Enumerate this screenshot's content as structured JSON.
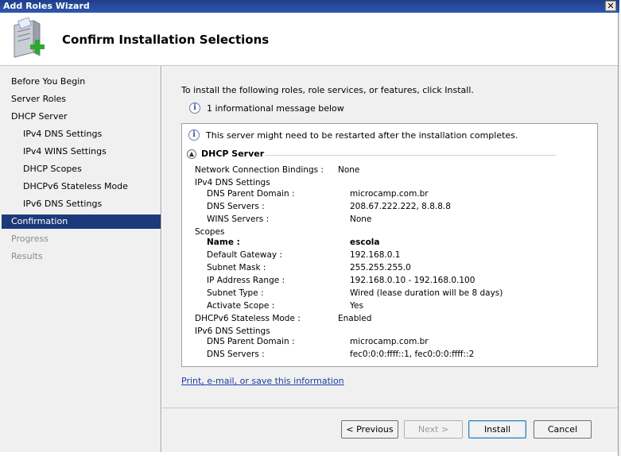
{
  "window": {
    "title": "Add Roles Wizard",
    "close_glyph": "✕"
  },
  "header": {
    "title": "Confirm Installation Selections",
    "icon": "server-add-icon"
  },
  "sidebar": {
    "items": [
      {
        "label": "Before You Begin",
        "state": "normal",
        "level": 0
      },
      {
        "label": "Server Roles",
        "state": "normal",
        "level": 0
      },
      {
        "label": "DHCP Server",
        "state": "normal",
        "level": 0
      },
      {
        "label": "IPv4 DNS Settings",
        "state": "normal",
        "level": 1
      },
      {
        "label": "IPv4 WINS Settings",
        "state": "normal",
        "level": 1
      },
      {
        "label": "DHCP Scopes",
        "state": "normal",
        "level": 1
      },
      {
        "label": "DHCPv6 Stateless Mode",
        "state": "normal",
        "level": 1
      },
      {
        "label": "IPv6 DNS Settings",
        "state": "normal",
        "level": 1
      },
      {
        "label": "Confirmation",
        "state": "active",
        "level": 0
      },
      {
        "label": "Progress",
        "state": "disabled",
        "level": 0
      },
      {
        "label": "Results",
        "state": "disabled",
        "level": 0
      }
    ]
  },
  "content": {
    "intro": "To install the following roles, role services, or features, click Install.",
    "info_message": "1 informational message below",
    "restart_notice": "This server might need to be restarted after the installation completes.",
    "section_title": "DHCP Server",
    "details": [
      {
        "label": "Network Connection Bindings :",
        "value": "None",
        "level": 0,
        "bold": false
      },
      {
        "label": "IPv4 DNS Settings",
        "value": "",
        "level": 0,
        "bold": false
      },
      {
        "label": "DNS Parent Domain :",
        "value": "microcamp.com.br",
        "level": 1,
        "bold": false
      },
      {
        "label": "DNS Servers :",
        "value": "208.67.222.222, 8.8.8.8",
        "level": 1,
        "bold": false
      },
      {
        "label": "WINS Servers :",
        "value": "None",
        "level": 1,
        "bold": false
      },
      {
        "label": "Scopes",
        "value": "",
        "level": 0,
        "bold": false
      },
      {
        "label": "Name :",
        "value": "escola",
        "level": 1,
        "bold": true
      },
      {
        "label": "Default Gateway :",
        "value": "192.168.0.1",
        "level": 1,
        "bold": false
      },
      {
        "label": "Subnet Mask :",
        "value": "255.255.255.0",
        "level": 1,
        "bold": false
      },
      {
        "label": "IP Address Range :",
        "value": "192.168.0.10 - 192.168.0.100",
        "level": 1,
        "bold": false
      },
      {
        "label": "Subnet Type :",
        "value": "Wired (lease duration will be 8 days)",
        "level": 1,
        "bold": false
      },
      {
        "label": "Activate Scope :",
        "value": "Yes",
        "level": 1,
        "bold": false
      },
      {
        "label": "DHCPv6 Stateless Mode :",
        "value": "Enabled",
        "level": 0,
        "bold": false
      },
      {
        "label": "IPv6 DNS Settings",
        "value": "",
        "level": 0,
        "bold": false
      },
      {
        "label": "DNS Parent Domain :",
        "value": "microcamp.com.br",
        "level": 1,
        "bold": false
      },
      {
        "label": "DNS Servers :",
        "value": "fec0:0:0:ffff::1, fec0:0:0:ffff::2",
        "level": 1,
        "bold": false
      }
    ],
    "link": "Print, e-mail, or save this information"
  },
  "buttons": {
    "previous": "< Previous",
    "next": "Next >",
    "install": "Install",
    "cancel": "Cancel"
  }
}
